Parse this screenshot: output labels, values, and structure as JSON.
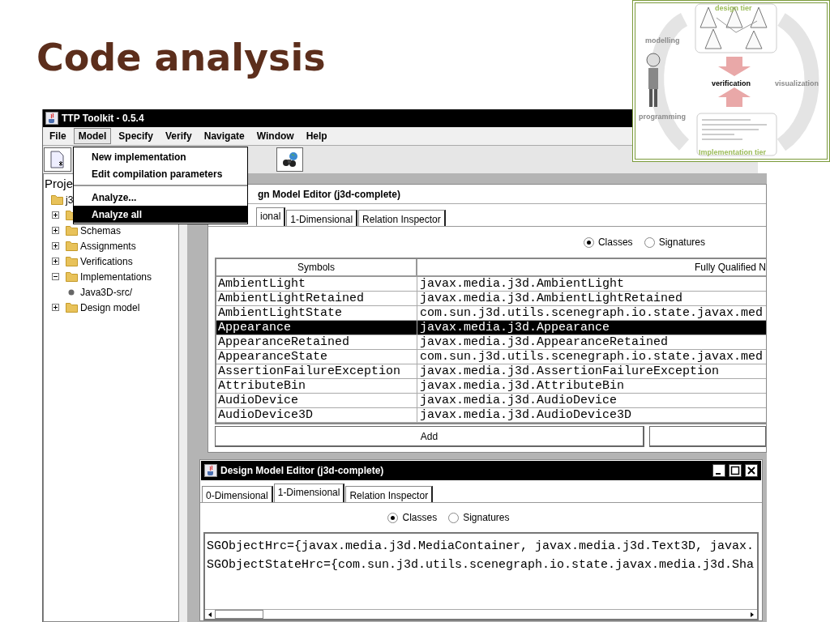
{
  "slide_title": "Code analysis",
  "window": {
    "title": "TTP Toolkit - 0.5.4"
  },
  "menu_bar": [
    {
      "label": "File",
      "selected": false
    },
    {
      "label": "Model",
      "selected": true
    },
    {
      "label": "Specify",
      "selected": false
    },
    {
      "label": "Verify",
      "selected": false
    },
    {
      "label": "Navigate",
      "selected": false
    },
    {
      "label": "Window",
      "selected": false
    },
    {
      "label": "Help",
      "selected": false
    }
  ],
  "open_menu": [
    {
      "kind": "item",
      "label": "New implementation",
      "selected": false
    },
    {
      "kind": "item",
      "label": "Edit compilation parameters",
      "selected": false
    },
    {
      "kind": "separator"
    },
    {
      "kind": "item",
      "label": "Analyze...",
      "selected": false
    },
    {
      "kind": "item",
      "label": "Analyze all",
      "selected": true
    }
  ],
  "project_panel": {
    "header": "Proje",
    "tree": [
      {
        "label": "j3",
        "children": [
          {
            "expanded": false
          },
          {
            "label": "Schemas",
            "expanded": false
          },
          {
            "label": "Assignments",
            "expanded": false
          },
          {
            "label": "Verifications",
            "expanded": false
          },
          {
            "label": "Implementations",
            "expanded": true,
            "children": [
              {
                "label": "Java3D-src/"
              }
            ]
          },
          {
            "label": "Design model",
            "expanded": false
          }
        ]
      }
    ]
  },
  "upper_editor": {
    "title": "gn Model Editor (j3d-complete)",
    "tabs": [
      {
        "label": "ional",
        "selected": true
      },
      {
        "label": "1-Dimensional",
        "selected": false
      },
      {
        "label": "Relation Inspector",
        "selected": false
      }
    ],
    "radios": [
      {
        "label": "Classes",
        "selected": true
      },
      {
        "label": "Signatures",
        "selected": false
      }
    ],
    "table": {
      "columns": [
        "Symbols",
        "Fully Qualified N"
      ],
      "rows": [
        {
          "cells": [
            "AmbientLight",
            "javax.media.j3d.AmbientLight"
          ],
          "selected": false
        },
        {
          "cells": [
            "AmbientLightRetained",
            "javax.media.j3d.AmbientLightRetained"
          ],
          "selected": false
        },
        {
          "cells": [
            "AmbientLightState",
            "com.sun.j3d.utils.scenegraph.io.state.javax.med"
          ],
          "selected": false
        },
        {
          "cells": [
            "Appearance",
            "javax.media.j3d.Appearance"
          ],
          "selected": true
        },
        {
          "cells": [
            "AppearanceRetained",
            "javax.media.j3d.AppearanceRetained"
          ],
          "selected": false
        },
        {
          "cells": [
            "AppearanceState",
            "com.sun.j3d.utils.scenegraph.io.state.javax.med"
          ],
          "selected": false
        },
        {
          "cells": [
            "AssertionFailureException",
            "javax.media.j3d.AssertionFailureException"
          ],
          "selected": false
        },
        {
          "cells": [
            "AttributeBin",
            "javax.media.j3d.AttributeBin"
          ],
          "selected": false
        },
        {
          "cells": [
            "AudioDevice",
            "javax.media.j3d.AudioDevice"
          ],
          "selected": false
        },
        {
          "cells": [
            "AudioDevice3D",
            "javax.media.j3d.AudioDevice3D"
          ],
          "selected": false
        }
      ]
    },
    "buttons": [
      "Add"
    ]
  },
  "lower_editor": {
    "title": "Design Model Editor (j3d-complete)",
    "tabs": [
      {
        "label": "0-Dimensional",
        "selected": false
      },
      {
        "label": "1-Dimensional",
        "selected": true
      },
      {
        "label": "Relation Inspector",
        "selected": false
      }
    ],
    "radios": [
      {
        "label": "Classes",
        "selected": true
      },
      {
        "label": "Signatures",
        "selected": false
      }
    ],
    "text_lines": [
      "SGObjectHrc={javax.media.j3d.MediaContainer, javax.media.j3d.Text3D, javax.",
      "SGObjectStateHrc={com.sun.j3d.utils.scenegraph.io.state.javax.media.j3d.Sha"
    ]
  },
  "inset_diagram": {
    "design_tier": "design tier",
    "modelling": "modelling",
    "verification": "verification",
    "visualization": "visualization",
    "programming": "programming",
    "implementation_tier": "Implementation tier"
  }
}
